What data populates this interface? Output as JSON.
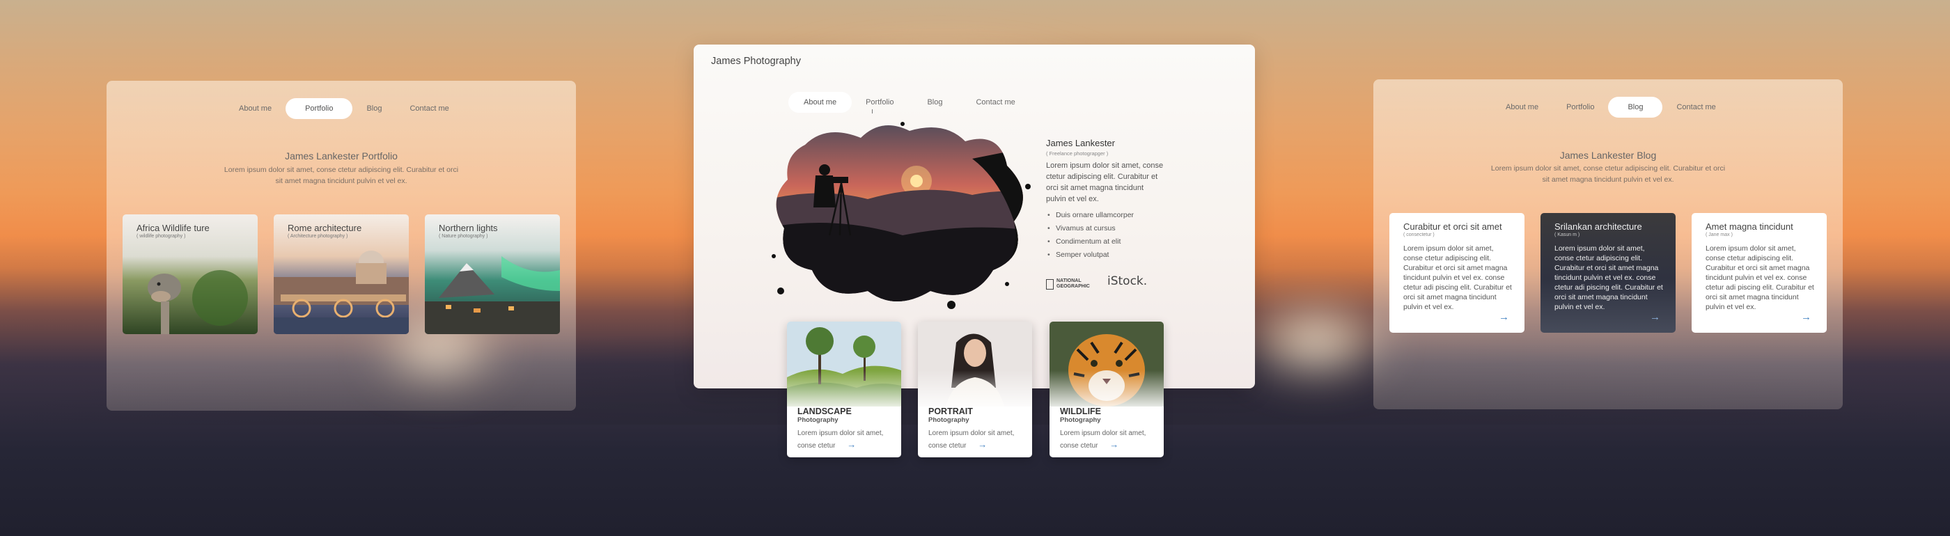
{
  "left_panel": {
    "nav": [
      "About me",
      "Portfolio",
      "Blog",
      "Contact me"
    ],
    "active_nav": "Portfolio",
    "title": "James Lankester Portfolio",
    "description_line1": "Lorem ipsum dolor sit amet, conse ctetur adipiscing elit. Curabitur et orci",
    "description_line2": "sit amet magna tincidunt pulvin et vel ex.",
    "cards": [
      {
        "title": "Africa Wildlife ture",
        "subtitle": "( wildlife photography )"
      },
      {
        "title": "Rome architecture",
        "subtitle": "( Architecture photography )"
      },
      {
        "title": "Northern lights",
        "subtitle": "( Nature photography )"
      }
    ]
  },
  "center_panel": {
    "brand": "James Photography",
    "nav": [
      "About me",
      "Portfolio",
      "Blog",
      "Contact me"
    ],
    "active_nav": "About me",
    "bio": {
      "name": "James Lankester",
      "role": "( Freelance photograpger )",
      "text": "Lorem ipsum dolor sit amet, conse ctetur adipiscing elit. Curabitur et orci sit amet magna tincidunt pulvin et vel ex.",
      "bullets": [
        "Duis ornare ullamcorper",
        "Vivamus at cursus",
        "Condimentum at elit",
        "Semper volutpat"
      ]
    },
    "logos": {
      "natgeo_line1": "NATIONAL",
      "natgeo_line2": "GEOGRAPHIC",
      "istock": "iStock."
    },
    "cards": [
      {
        "title": "LANDSCAPE",
        "subtitle": "Photography",
        "text_line1": "Lorem ipsum dolor sit amet,",
        "text_line2": "conse ctetur"
      },
      {
        "title": "PORTRAIT",
        "subtitle": "Photography",
        "text_line1": "Lorem ipsum dolor sit amet,",
        "text_line2": "conse ctetur"
      },
      {
        "title": "WILDLIFE",
        "subtitle": "Photography",
        "text_line1": "Lorem ipsum dolor sit amet,",
        "text_line2": "conse ctetur"
      }
    ]
  },
  "right_panel": {
    "nav": [
      "About me",
      "Portfolio",
      "Blog",
      "Contact me"
    ],
    "active_nav": "Blog",
    "title": "James Lankester Blog",
    "description_line1": "Lorem ipsum dolor sit amet, conse ctetur adipiscing elit. Curabitur et orci",
    "description_line2": "sit amet magna tincidunt pulvin et vel ex.",
    "posts": [
      {
        "title": "Curabitur et orci sit amet",
        "subtitle": "( consectetur )",
        "text": "Lorem ipsum dolor sit amet, conse ctetur adipiscing elit. Curabitur et orci sit amet magna tincidunt pulvin et vel ex. conse ctetur adi piscing elit. Curabitur et orci sit amet magna tincidunt pulvin et vel ex.",
        "style": "light"
      },
      {
        "title": "Srilankan architecture",
        "subtitle": "( Kasun m )",
        "text": "Lorem ipsum dolor sit amet, conse ctetur adipiscing elit. Curabitur et orci sit amet magna tincidunt pulvin et vel ex. conse ctetur adi piscing elit. Curabitur et orci sit amet magna tincidunt pulvin et vel ex.",
        "style": "dark"
      },
      {
        "title": "Amet magna tincidunt",
        "subtitle": "( Jane max )",
        "text": "Lorem ipsum dolor sit amet, conse ctetur adipiscing elit. Curabitur et orci sit amet magna tincidunt pulvin et vel ex. conse ctetur adi piscing elit. Curabitur et orci sit amet magna tincidunt pulvin et vel ex.",
        "style": "light"
      }
    ]
  },
  "colors": {
    "accent": "#3f7fc0",
    "panel": "#fbfaf8"
  },
  "icons": [
    "arrow-right-icon",
    "national-geographic-logo",
    "istock-logo"
  ]
}
